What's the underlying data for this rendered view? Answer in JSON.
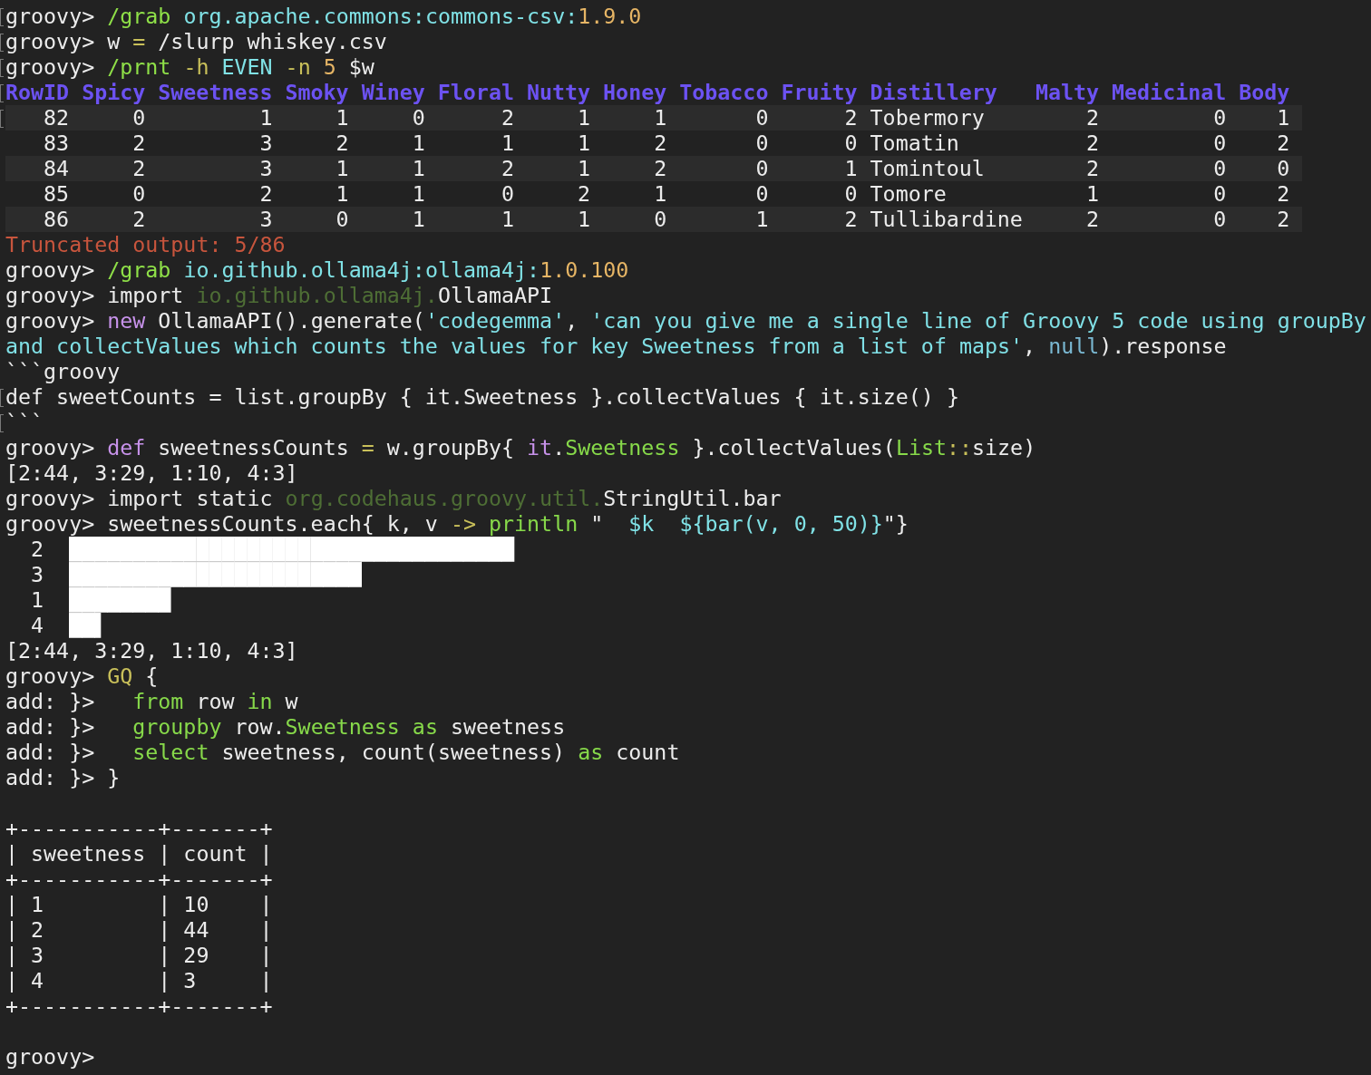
{
  "terminal": {
    "blocks": [
      {
        "kind": "line",
        "marked": true,
        "segments": [
          {
            "t": "groovy> ",
            "kind": "plain"
          },
          {
            "t": "/grab",
            "kind": "cmd"
          },
          {
            "t": " org.apache.commons:commons-csv:",
            "kind": "ident"
          },
          {
            "t": "1.9.0",
            "kind": "num"
          }
        ]
      },
      {
        "kind": "line",
        "marked": true,
        "segments": [
          {
            "t": "groovy> w ",
            "kind": "plain"
          },
          {
            "t": "=",
            "kind": "op"
          },
          {
            "t": " /slurp whiskey.csv",
            "kind": "plain"
          }
        ]
      },
      {
        "kind": "line",
        "marked": true,
        "segments": [
          {
            "t": "groovy> ",
            "kind": "plain"
          },
          {
            "t": "/prnt",
            "kind": "cmd"
          },
          {
            "t": " -h",
            "kind": "op"
          },
          {
            "t": " EVEN",
            "kind": "ident"
          },
          {
            "t": " -n",
            "kind": "op"
          },
          {
            "t": " 5",
            "kind": "num"
          },
          {
            "t": " $w",
            "kind": "plain"
          }
        ]
      },
      {
        "kind": "table",
        "marked": true,
        "columns": [
          {
            "name": "RowID",
            "kind": "numeric"
          },
          {
            "name": "Spicy",
            "kind": "numeric"
          },
          {
            "name": "Sweetness",
            "kind": "numeric"
          },
          {
            "name": "Smoky",
            "kind": "numeric"
          },
          {
            "name": "Winey",
            "kind": "numeric"
          },
          {
            "name": "Floral",
            "kind": "numeric"
          },
          {
            "name": "Nutty",
            "kind": "numeric"
          },
          {
            "name": "Honey",
            "kind": "numeric"
          },
          {
            "name": "Tobacco",
            "kind": "numeric"
          },
          {
            "name": "Fruity",
            "kind": "numeric"
          },
          {
            "name": "Distillery",
            "kind": "text"
          },
          {
            "name": "Malty",
            "kind": "numeric"
          },
          {
            "name": "Medicinal",
            "kind": "numeric"
          },
          {
            "name": "Body",
            "kind": "numeric"
          }
        ],
        "rows": [
          {
            "marked": true,
            "cells": [
              "82",
              "0",
              "1",
              "1",
              "0",
              "2",
              "1",
              "1",
              "0",
              "2",
              "Tobermory",
              "2",
              "0",
              "1"
            ]
          },
          {
            "cells": [
              "83",
              "2",
              "3",
              "2",
              "1",
              "1",
              "1",
              "2",
              "0",
              "0",
              "Tomatin",
              "2",
              "0",
              "2"
            ]
          },
          {
            "cells": [
              "84",
              "2",
              "3",
              "1",
              "1",
              "2",
              "1",
              "2",
              "0",
              "1",
              "Tomintoul",
              "2",
              "0",
              "0"
            ]
          },
          {
            "cells": [
              "85",
              "0",
              "2",
              "1",
              "1",
              "0",
              "2",
              "1",
              "0",
              "0",
              "Tomore",
              "1",
              "0",
              "2"
            ]
          },
          {
            "cells": [
              "86",
              "2",
              "3",
              "0",
              "1",
              "1",
              "1",
              "0",
              "1",
              "2",
              "Tullibardine",
              "2",
              "0",
              "2"
            ]
          }
        ]
      },
      {
        "kind": "line",
        "segments": [
          {
            "t": "Truncated output: 5/86",
            "kind": "warn"
          }
        ]
      },
      {
        "kind": "line",
        "segments": [
          {
            "t": "groovy> ",
            "kind": "plain"
          },
          {
            "t": "/grab",
            "kind": "cmd"
          },
          {
            "t": " io.github.ollama4j:ollama4j:",
            "kind": "ident"
          },
          {
            "t": "1.0.100",
            "kind": "num"
          }
        ]
      },
      {
        "kind": "line",
        "segments": [
          {
            "t": "groovy> import ",
            "kind": "plain"
          },
          {
            "t": "io.github.ollama4j.",
            "kind": "pkg"
          },
          {
            "t": "OllamaAPI",
            "kind": "plain"
          }
        ]
      },
      {
        "kind": "line",
        "segments": [
          {
            "t": "groovy> ",
            "kind": "plain"
          },
          {
            "t": "new",
            "kind": "kw"
          },
          {
            "t": " OllamaAPI().generate(",
            "kind": "plain"
          },
          {
            "t": "'codegemma'",
            "kind": "str"
          },
          {
            "t": ", ",
            "kind": "plain"
          },
          {
            "t": "'can you give me a single line of Groovy 5 code using groupBy",
            "kind": "str"
          }
        ]
      },
      {
        "kind": "line",
        "segments": [
          {
            "t": "and collectValues which counts the values for key Sweetness from a list of maps'",
            "kind": "str"
          },
          {
            "t": ", ",
            "kind": "plain"
          },
          {
            "t": "null",
            "kind": "null"
          },
          {
            "t": ").response",
            "kind": "plain"
          }
        ]
      },
      {
        "kind": "line",
        "segments": [
          {
            "t": "```groovy",
            "kind": "plain"
          }
        ]
      },
      {
        "kind": "line",
        "marked": true,
        "segments": [
          {
            "t": "def sweetCounts = list.groupBy { it.Sweetness }.collectValues { it.size() }",
            "kind": "plain"
          }
        ]
      },
      {
        "kind": "line",
        "marked": true,
        "segments": [
          {
            "t": "```",
            "kind": "plain"
          }
        ]
      },
      {
        "kind": "line",
        "segments": [
          {
            "t": "groovy> ",
            "kind": "plain"
          },
          {
            "t": "def",
            "kind": "kw"
          },
          {
            "t": " sweetnessCounts ",
            "kind": "plain"
          },
          {
            "t": "=",
            "kind": "op"
          },
          {
            "t": " w.groupBy{ ",
            "kind": "plain"
          },
          {
            "t": "it",
            "kind": "kw"
          },
          {
            "t": ".",
            "kind": "plain"
          },
          {
            "t": "Sweetness",
            "kind": "prop"
          },
          {
            "t": " }.collectValues(",
            "kind": "plain"
          },
          {
            "t": "List",
            "kind": "prop"
          },
          {
            "t": "::",
            "kind": "op"
          },
          {
            "t": "size)",
            "kind": "plain"
          }
        ]
      },
      {
        "kind": "line",
        "segments": [
          {
            "t": "[2:44, 3:29, 1:10, 4:3]",
            "kind": "plain"
          }
        ]
      },
      {
        "kind": "line",
        "segments": [
          {
            "t": "groovy> import static ",
            "kind": "plain"
          },
          {
            "t": "org.codehaus.groovy.util.",
            "kind": "pkg"
          },
          {
            "t": "StringUtil.bar",
            "kind": "plain"
          }
        ]
      },
      {
        "kind": "line",
        "segments": [
          {
            "t": "groovy> sweetnessCounts.each{ k, v ",
            "kind": "plain"
          },
          {
            "t": "->",
            "kind": "op"
          },
          {
            "t": " println",
            "kind": "prop"
          },
          {
            "t": " \"  ",
            "kind": "plain"
          },
          {
            "t": "$k",
            "kind": "ident"
          },
          {
            "t": "  ${bar(v, 0, 50)}",
            "kind": "ident"
          },
          {
            "t": "\"}",
            "kind": "plain"
          }
        ]
      },
      {
        "kind": "line",
        "segments": [
          {
            "t": "  2  ",
            "kind": "plain"
          },
          {
            "t": "███████████████████████████████████",
            "kind": "bar"
          }
        ]
      },
      {
        "kind": "line",
        "segments": [
          {
            "t": "  3  ",
            "kind": "plain"
          },
          {
            "t": "███████████████████████",
            "kind": "bar"
          }
        ]
      },
      {
        "kind": "line",
        "segments": [
          {
            "t": "  1  ",
            "kind": "plain"
          },
          {
            "t": "████████",
            "kind": "bar"
          }
        ]
      },
      {
        "kind": "line",
        "segments": [
          {
            "t": "  4  ",
            "kind": "plain"
          },
          {
            "t": "██▌",
            "kind": "bar"
          }
        ]
      },
      {
        "kind": "line",
        "segments": [
          {
            "t": "[2:44, 3:29, 1:10, 4:3]",
            "kind": "plain"
          }
        ]
      },
      {
        "kind": "line",
        "segments": [
          {
            "t": "groovy> ",
            "kind": "plain"
          },
          {
            "t": "GQ",
            "kind": "op"
          },
          {
            "t": " {",
            "kind": "plain"
          }
        ]
      },
      {
        "kind": "line",
        "segments": [
          {
            "t": "add: }>   ",
            "kind": "plain"
          },
          {
            "t": "from",
            "kind": "prop"
          },
          {
            "t": " row ",
            "kind": "plain"
          },
          {
            "t": "in",
            "kind": "prop"
          },
          {
            "t": " w",
            "kind": "plain"
          }
        ]
      },
      {
        "kind": "line",
        "segments": [
          {
            "t": "add: }>   ",
            "kind": "plain"
          },
          {
            "t": "groupby",
            "kind": "prop"
          },
          {
            "t": " row.",
            "kind": "plain"
          },
          {
            "t": "Sweetness",
            "kind": "prop"
          },
          {
            "t": " as",
            "kind": "prop"
          },
          {
            "t": " sweetness",
            "kind": "plain"
          }
        ]
      },
      {
        "kind": "line",
        "segments": [
          {
            "t": "add: }>   ",
            "kind": "plain"
          },
          {
            "t": "select",
            "kind": "prop"
          },
          {
            "t": " sweetness, count(sweetness) ",
            "kind": "plain"
          },
          {
            "t": "as",
            "kind": "prop"
          },
          {
            "t": " count",
            "kind": "plain"
          }
        ]
      },
      {
        "kind": "line",
        "segments": [
          {
            "t": "add: }> }",
            "kind": "plain"
          }
        ]
      },
      {
        "kind": "blank"
      },
      {
        "kind": "line",
        "segments": [
          {
            "t": "+-----------+-------+",
            "kind": "plain"
          }
        ]
      },
      {
        "kind": "line",
        "segments": [
          {
            "t": "| sweetness | count |",
            "kind": "plain"
          }
        ]
      },
      {
        "kind": "line",
        "segments": [
          {
            "t": "+-----------+-------+",
            "kind": "plain"
          }
        ]
      },
      {
        "kind": "line",
        "segments": [
          {
            "t": "| 1         | 10    |",
            "kind": "plain"
          }
        ]
      },
      {
        "kind": "line",
        "segments": [
          {
            "t": "| 2         | 44    |",
            "kind": "plain"
          }
        ]
      },
      {
        "kind": "line",
        "segments": [
          {
            "t": "| 3         | 29    |",
            "kind": "plain"
          }
        ]
      },
      {
        "kind": "line",
        "segments": [
          {
            "t": "| 4         | 3     |",
            "kind": "plain"
          }
        ]
      },
      {
        "kind": "line",
        "segments": [
          {
            "t": "+-----------+-------+",
            "kind": "plain"
          }
        ]
      },
      {
        "kind": "blank"
      },
      {
        "kind": "line",
        "segments": [
          {
            "t": "groovy>",
            "kind": "plain"
          }
        ]
      }
    ]
  }
}
